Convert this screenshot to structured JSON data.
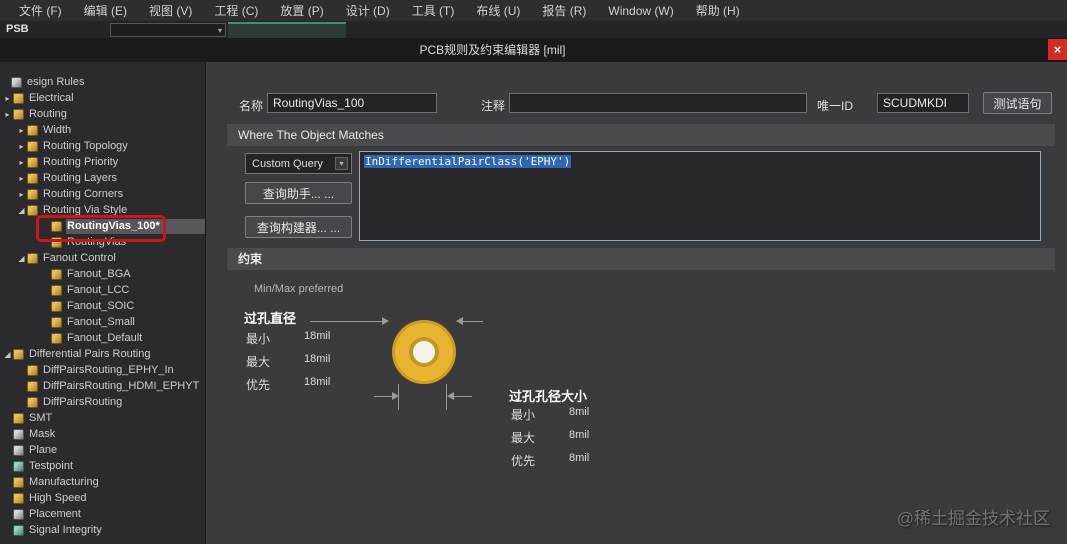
{
  "menu": {
    "items": [
      "文件 (F)",
      "编辑 (E)",
      "视图 (V)",
      "工程 (C)",
      "放置 (P)",
      "设计 (D)",
      "工具 (T)",
      "布线 (U)",
      "报告 (R)",
      "Window (W)",
      "帮助 (H)"
    ]
  },
  "strip": {
    "doc_label": "PSB"
  },
  "dialog": {
    "title": "PCB规则及约束编辑器 [mil]",
    "close_glyph": "×"
  },
  "icons": {
    "collapsed": "▸",
    "expanded": "◢",
    "dropdown": "▾"
  },
  "tree": {
    "items": [
      {
        "label": "esign Rules",
        "level": 0,
        "arrow": "",
        "icon": "design-rules-icon"
      },
      {
        "label": "Electrical",
        "level": 1,
        "arrow": "collapsed",
        "icon": "electrical-icon"
      },
      {
        "label": "Routing",
        "level": 1,
        "arrow": "collapsed",
        "icon": "routing-icon"
      },
      {
        "label": "Width",
        "level": 2,
        "arrow": "collapsed",
        "icon": "rule-icon"
      },
      {
        "label": "Routing Topology",
        "level": 2,
        "arrow": "collapsed",
        "icon": "rule-icon"
      },
      {
        "label": "Routing Priority",
        "level": 2,
        "arrow": "collapsed",
        "icon": "rule-icon"
      },
      {
        "label": "Routing Layers",
        "level": 2,
        "arrow": "collapsed",
        "icon": "rule-icon"
      },
      {
        "label": "Routing Corners",
        "level": 2,
        "arrow": "collapsed",
        "icon": "rule-icon"
      },
      {
        "label": "Routing Via Style",
        "level": 2,
        "arrow": "expanded",
        "icon": "rule-icon"
      },
      {
        "label": "RoutingVias_100*",
        "level": 3,
        "arrow": "",
        "icon": "rule-icon",
        "selected": true
      },
      {
        "label": "RoutingVias",
        "level": 3,
        "arrow": "",
        "icon": "rule-icon"
      },
      {
        "label": "Fanout Control",
        "level": 2,
        "arrow": "expanded",
        "icon": "rule-icon"
      },
      {
        "label": "Fanout_BGA",
        "level": 3,
        "arrow": "",
        "icon": "rule-icon"
      },
      {
        "label": "Fanout_LCC",
        "level": 3,
        "arrow": "",
        "icon": "rule-icon"
      },
      {
        "label": "Fanout_SOIC",
        "level": 3,
        "arrow": "",
        "icon": "rule-icon"
      },
      {
        "label": "Fanout_Small",
        "level": 3,
        "arrow": "",
        "icon": "rule-icon"
      },
      {
        "label": "Fanout_Default",
        "level": 3,
        "arrow": "",
        "icon": "rule-icon"
      },
      {
        "label": "Differential Pairs Routing",
        "level": 1,
        "arrow": "expanded",
        "icon": "rule-icon"
      },
      {
        "label": "DiffPairsRouting_EPHY_In",
        "level": 2,
        "arrow": "",
        "icon": "rule-icon"
      },
      {
        "label": "DiffPairsRouting_HDMI_EPHYT",
        "level": 2,
        "arrow": "",
        "icon": "rule-icon"
      },
      {
        "label": "DiffPairsRouting",
        "level": 2,
        "arrow": "",
        "icon": "rule-icon"
      },
      {
        "label": "SMT",
        "level": 1,
        "arrow": "",
        "icon": "smt-icon"
      },
      {
        "label": "Mask",
        "level": 1,
        "arrow": "",
        "icon": "mask-icon"
      },
      {
        "label": "Plane",
        "level": 1,
        "arrow": "",
        "icon": "plane-icon"
      },
      {
        "label": "Testpoint",
        "level": 1,
        "arrow": "",
        "icon": "testpoint-icon"
      },
      {
        "label": "Manufacturing",
        "level": 1,
        "arrow": "",
        "icon": "manufacturing-icon"
      },
      {
        "label": "High Speed",
        "level": 1,
        "arrow": "",
        "icon": "high-speed-icon"
      },
      {
        "label": "Placement",
        "level": 1,
        "arrow": "",
        "icon": "placement-icon"
      },
      {
        "label": "Signal Integrity",
        "level": 1,
        "arrow": "",
        "icon": "signal-integrity-icon"
      }
    ]
  },
  "form": {
    "name_label": "名称",
    "name_value": "RoutingVias_100",
    "comment_label": "注释",
    "comment_value": "",
    "uid_label": "唯一ID",
    "uid_value": "SCUDMKDI",
    "test_button": "测试语句"
  },
  "match": {
    "header": "Where The Object Matches",
    "query_type": "Custom Query",
    "query_text": "InDifferentialPairClass('EPHY')",
    "helper_button": "查询助手... ...",
    "builder_button": "查询构建器... ..."
  },
  "constraints": {
    "header": "约束",
    "minmax_label": "Min/Max preferred",
    "via_diameter": {
      "title": "过孔直径",
      "rows": [
        {
          "label": "最小",
          "value": "18mil"
        },
        {
          "label": "最大",
          "value": "18mil"
        },
        {
          "label": "优先",
          "value": "18mil"
        }
      ]
    },
    "via_hole": {
      "title": "过孔孔径大小",
      "rows": [
        {
          "label": "最小",
          "value": "8mil"
        },
        {
          "label": "最大",
          "value": "8mil"
        },
        {
          "label": "优先",
          "value": "8mil"
        }
      ]
    }
  },
  "watermark": "@稀土掘金技术社区"
}
